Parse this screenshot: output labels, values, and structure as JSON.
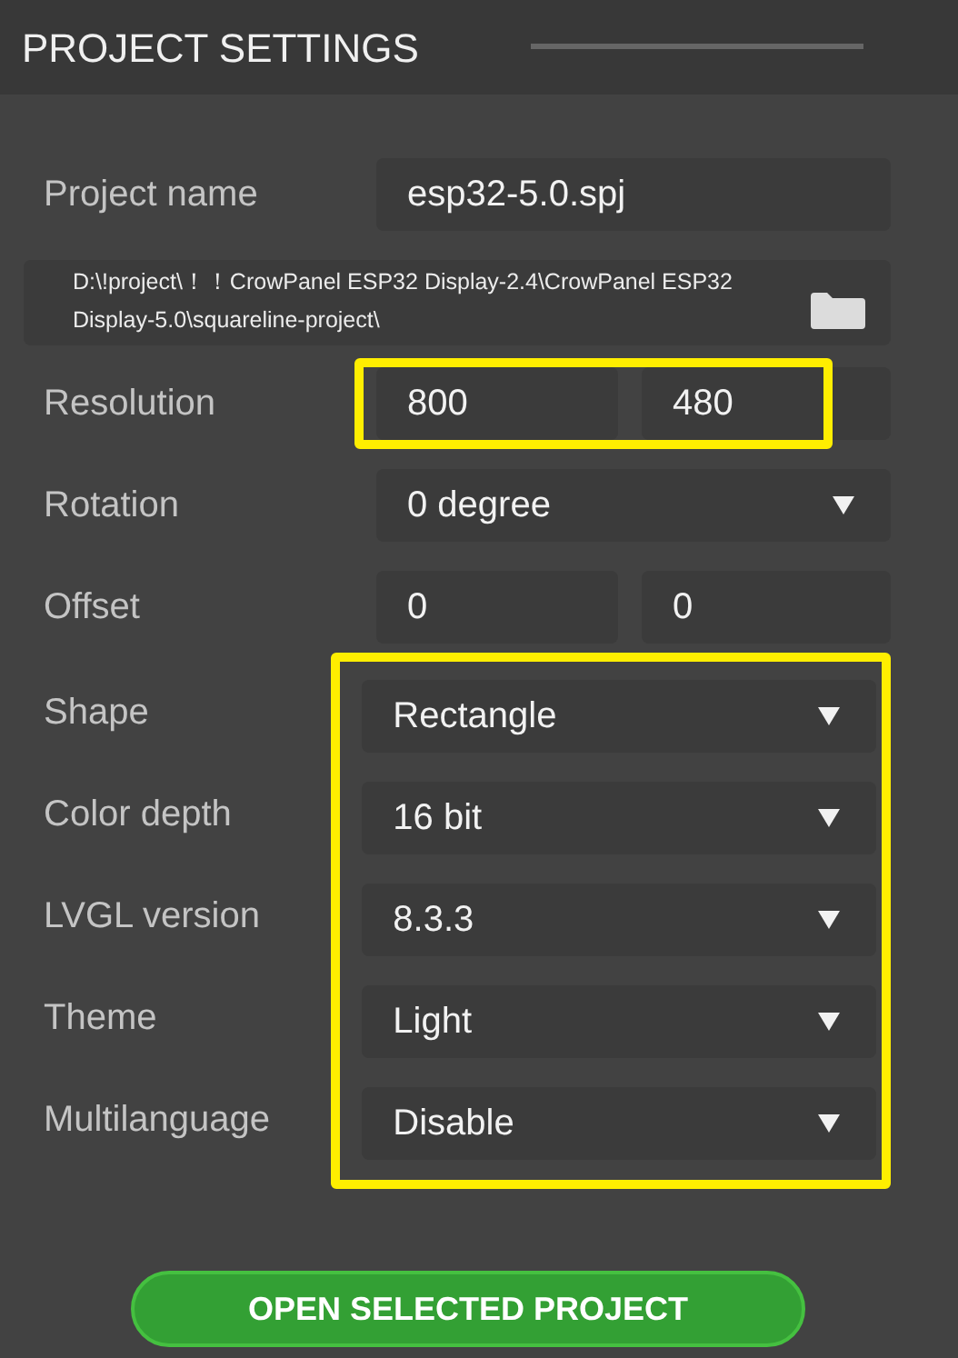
{
  "header": {
    "title": "PROJECT SETTINGS"
  },
  "sections": [
    {
      "highlighted": false,
      "rows": [
        {
          "kind": "text",
          "label": "Project name",
          "value": "esp32-5.0.spj"
        },
        {
          "kind": "path",
          "value": "D:\\!project\\！！CrowPanel ESP32 Display-2.4\\CrowPanel ESP32 Display-5.0\\squareline-project\\"
        },
        {
          "kind": "pair",
          "label": "Resolution",
          "values": [
            "800",
            "480"
          ],
          "highlighted": true
        },
        {
          "kind": "dropdown",
          "label": "Rotation",
          "value": "0 degree"
        },
        {
          "kind": "pair",
          "label": "Offset",
          "values": [
            "0",
            "0"
          ],
          "highlighted": false
        }
      ]
    },
    {
      "highlighted": true,
      "rows": [
        {
          "kind": "dropdown",
          "label": "Shape",
          "value": "Rectangle"
        },
        {
          "kind": "dropdown",
          "label": "Color depth",
          "value": "16 bit"
        },
        {
          "kind": "dropdown",
          "label": "LVGL version",
          "value": "8.3.3"
        },
        {
          "kind": "dropdown",
          "label": "Theme",
          "value": "Light"
        },
        {
          "kind": "dropdown",
          "label": "Multilanguage",
          "value": "Disable"
        }
      ]
    }
  ],
  "button": {
    "label": "OPEN SELECTED PROJECT"
  }
}
